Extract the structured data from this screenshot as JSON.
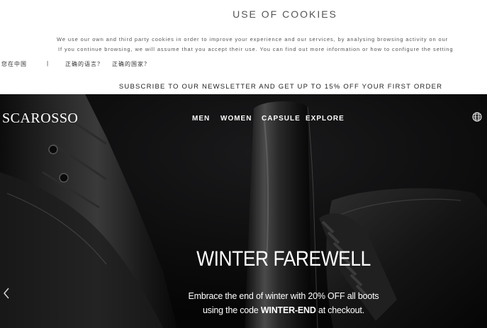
{
  "cookies": {
    "title": "USE OF COOKIES",
    "line1": "We use our own and third party cookies in order to improve your experience and our services, by analysing browsing activity on our",
    "line2": "If you continue browsing, we will assume that you accept their use. You can find out more information or how to configure the setting"
  },
  "locale": {
    "country": "您在中国",
    "separator": "|",
    "language_link": "正确的语言？",
    "region_link": "正确的国家？"
  },
  "newsletter": {
    "text": "SUBSCRIBE TO OUR NEWSLETTER AND GET UP TO 15% OFF YOUR FIRST ORDER"
  },
  "header": {
    "logo": "SCAROSSO",
    "nav": [
      "MEN",
      "WOMEN",
      "CAPSULE",
      "EXPLORE"
    ],
    "region_icon": "globe-icon"
  },
  "hero": {
    "title": "WINTER FAREWELL",
    "desc_line1": "Embrace the end of winter with 20% OFF all boots",
    "desc_line2_prefix": "using the code ",
    "promo_code": "WINTER-END",
    "desc_line2_suffix": " at checkout.",
    "prev_icon": "chevron-left-icon"
  },
  "colors": {
    "hero_background": "#070707",
    "text_light": "#ffffff",
    "text_dark": "#222222"
  }
}
